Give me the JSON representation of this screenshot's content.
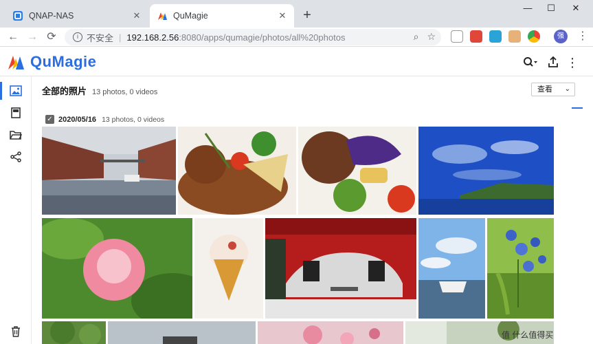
{
  "browser": {
    "tabs": [
      {
        "label": "QNAP-NAS",
        "active": false
      },
      {
        "label": "QuMagie",
        "active": true
      }
    ],
    "new_tab_glyph": "+",
    "window_controls": [
      "—",
      "☐",
      "✕"
    ],
    "address": {
      "insecure_label": "不安全",
      "host": "192.168.2.56",
      "path": ":8080/apps/qumagie/photos/all%20photos"
    },
    "profile_initial": "强"
  },
  "app": {
    "logo_text": "QuMagie",
    "brand_color": "#2a6ee0"
  },
  "rail": {
    "items": [
      {
        "name": "photos",
        "icon": "image-icon"
      },
      {
        "name": "albums",
        "icon": "album-icon"
      },
      {
        "name": "folders",
        "icon": "folder-icon"
      },
      {
        "name": "share",
        "icon": "share-icon"
      },
      {
        "name": "trash",
        "icon": "trash-icon"
      }
    ]
  },
  "main": {
    "title": "全部的照片",
    "subtitle": "13 photos, 0 videos",
    "view_select": "查看"
  },
  "group": {
    "date": "2020/05/16",
    "count": "13 photos, 0 videos"
  },
  "photos": [
    {
      "name": "red-brick-warehouses"
    },
    {
      "name": "plated-dish-herbs"
    },
    {
      "name": "roasted-vegetables"
    },
    {
      "name": "blue-sky-coast"
    },
    {
      "name": "pink-flower-bud"
    },
    {
      "name": "ice-cream-cone"
    },
    {
      "name": "audi-race-car"
    },
    {
      "name": "harbor-yacht"
    },
    {
      "name": "blue-wildflowers"
    },
    {
      "name": "green-trees"
    },
    {
      "name": "grey-sky-building"
    },
    {
      "name": "pink-blossoms"
    },
    {
      "name": "forest-path"
    }
  ],
  "watermark": "值 什么值得买"
}
